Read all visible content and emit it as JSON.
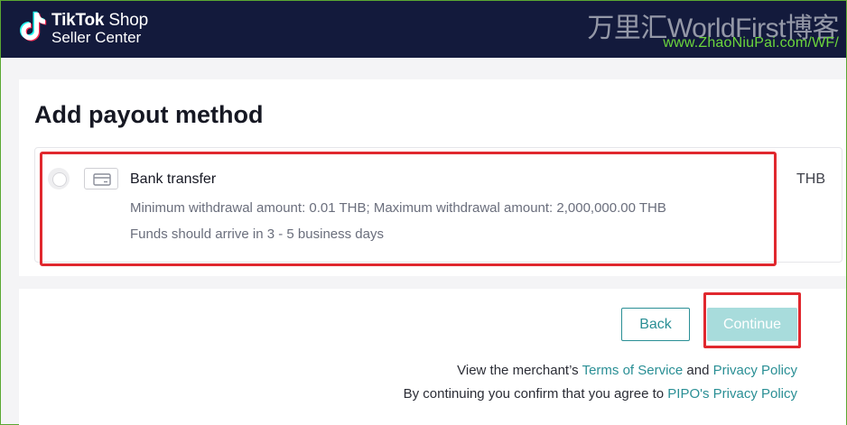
{
  "header": {
    "brand_name": "TikTok",
    "brand_shop": " Shop",
    "brand_sub": "Seller Center",
    "watermark_title": "万里汇WorldFirst博客",
    "watermark_url": "www.ZhaoNiuPai.com/WF/"
  },
  "page": {
    "title": "Add payout method"
  },
  "method": {
    "name": "Bank transfer",
    "limit": "Minimum withdrawal amount: 0.01 THB; Maximum withdrawal amount: 2,000,000.00 THB",
    "eta": "Funds should arrive in 3 - 5 business days",
    "currency": "THB",
    "icon": "bank-card-icon"
  },
  "actions": {
    "back_label": "Back",
    "continue_label": "Continue"
  },
  "legal": {
    "line1_prefix": "View the merchant’s ",
    "terms_link": "Terms of Service",
    "line1_and": " and ",
    "privacy_link": "Privacy Policy",
    "line2_prefix": "By continuing you confirm that you agree to ",
    "pipo_link": "PIPO's Privacy Policy"
  },
  "colors": {
    "header_bg": "#131a3c",
    "accent": "#2a8f95",
    "highlight": "#e0282e",
    "watermark_green": "#6cd63c"
  }
}
